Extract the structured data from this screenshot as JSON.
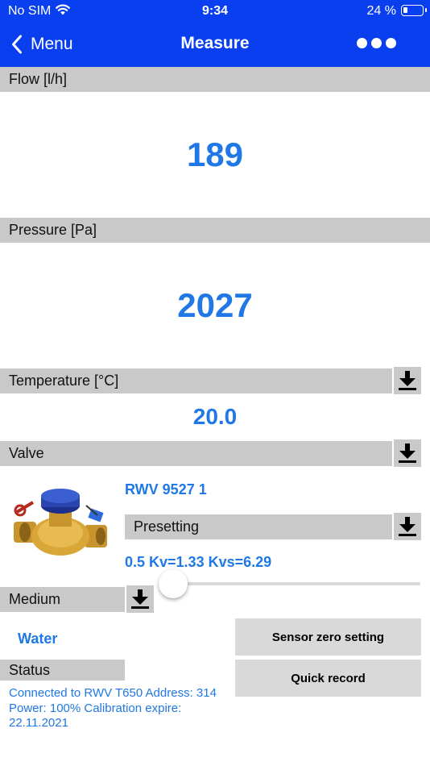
{
  "status_bar": {
    "carrier": "No SIM",
    "time": "9:34",
    "battery": "24 %"
  },
  "nav": {
    "back_label": "Menu",
    "title": "Measure"
  },
  "flow": {
    "header": "Flow [l/h]",
    "value": "189"
  },
  "pressure": {
    "header": "Pressure [Pa]",
    "value": "2027"
  },
  "temperature": {
    "header": "Temperature [°C]",
    "value": "20.0"
  },
  "valve": {
    "header": "Valve",
    "name": "RWV 9527 1",
    "presetting_header": "Presetting",
    "presetting_value": "0.5 Kv=1.33 Kvs=6.29",
    "presetting_slider_fraction": 0
  },
  "medium": {
    "header": "Medium",
    "value": "Water"
  },
  "buttons": {
    "sensor_zero": "Sensor zero setting",
    "quick_record": "Quick record"
  },
  "status": {
    "header": "Status",
    "text": "Connected to RWV T650 Address: 314 Power: 100% Calibration expire: 22.11.2021"
  },
  "colors": {
    "nav_blue": "#0a3ff0",
    "value_blue": "#1f78e5",
    "header_gray": "#c9c9c9"
  },
  "icons": [
    "wifi-icon",
    "battery-icon",
    "chevron-left-icon",
    "more-dots-icon",
    "download-icon"
  ]
}
